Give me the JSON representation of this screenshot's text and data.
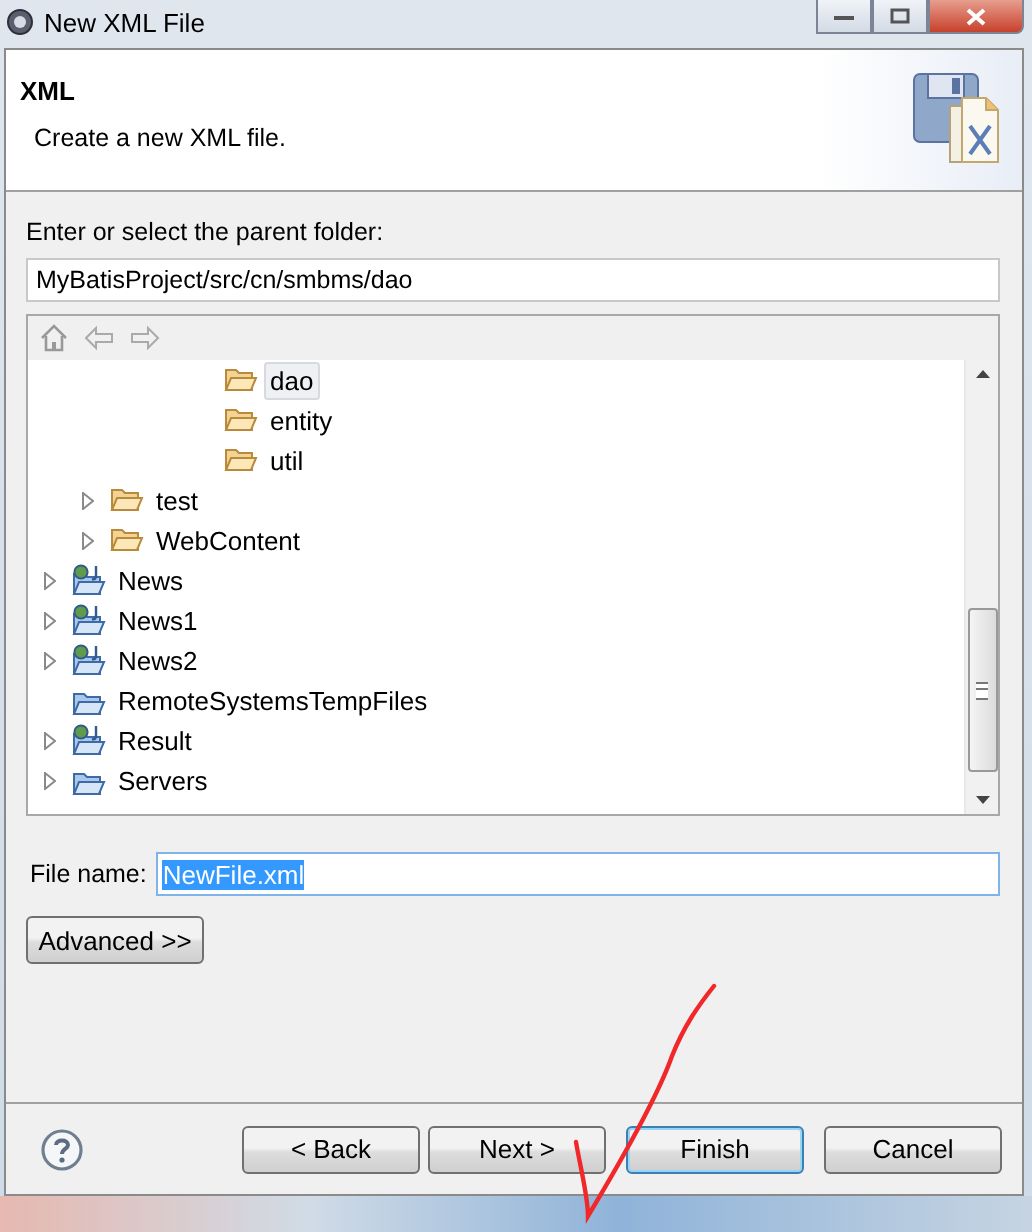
{
  "window": {
    "title": "New XML File"
  },
  "header": {
    "title": "XML",
    "description": "Create a new XML file."
  },
  "parent_folder": {
    "label": "Enter or select the parent folder:",
    "value": "MyBatisProject/src/cn/smbms/dao"
  },
  "tree": {
    "items": [
      {
        "children": [
          {
            "children": [
              {
                "children": [
                  {
                    "children": [
                      {
                        "label": "dao",
                        "kind": "folder",
                        "expandable": false,
                        "selected": true
                      },
                      {
                        "label": "entity",
                        "kind": "folder",
                        "expandable": false,
                        "selected": false
                      },
                      {
                        "label": "util",
                        "kind": "folder",
                        "expandable": false,
                        "selected": false
                      }
                    ]
                  }
                ]
              }
            ]
          },
          {
            "label": "test",
            "kind": "folder",
            "expandable": true,
            "selected": false
          },
          {
            "label": "WebContent",
            "kind": "folder",
            "expandable": true,
            "selected": false
          }
        ]
      },
      {
        "label": "News",
        "kind": "project",
        "expandable": true,
        "selected": false
      },
      {
        "label": "News1",
        "kind": "project",
        "expandable": true,
        "selected": false
      },
      {
        "label": "News2",
        "kind": "project",
        "expandable": true,
        "selected": false
      },
      {
        "label": "RemoteSystemsTempFiles",
        "kind": "plain-project",
        "expandable": false,
        "selected": false
      },
      {
        "label": "Result",
        "kind": "project",
        "expandable": true,
        "selected": false
      },
      {
        "label": "Servers",
        "kind": "plain-project",
        "expandable": true,
        "selected": false
      }
    ]
  },
  "file_name": {
    "label": "File name:",
    "value": "NewFile.xml",
    "text_selected": true
  },
  "advanced_button": {
    "label": "Advanced >>"
  },
  "buttons": [
    {
      "label": "< Back",
      "default": false
    },
    {
      "label": "Next >",
      "default": false
    },
    {
      "label": "Finish",
      "default": true
    },
    {
      "label": "Cancel",
      "default": false
    }
  ]
}
